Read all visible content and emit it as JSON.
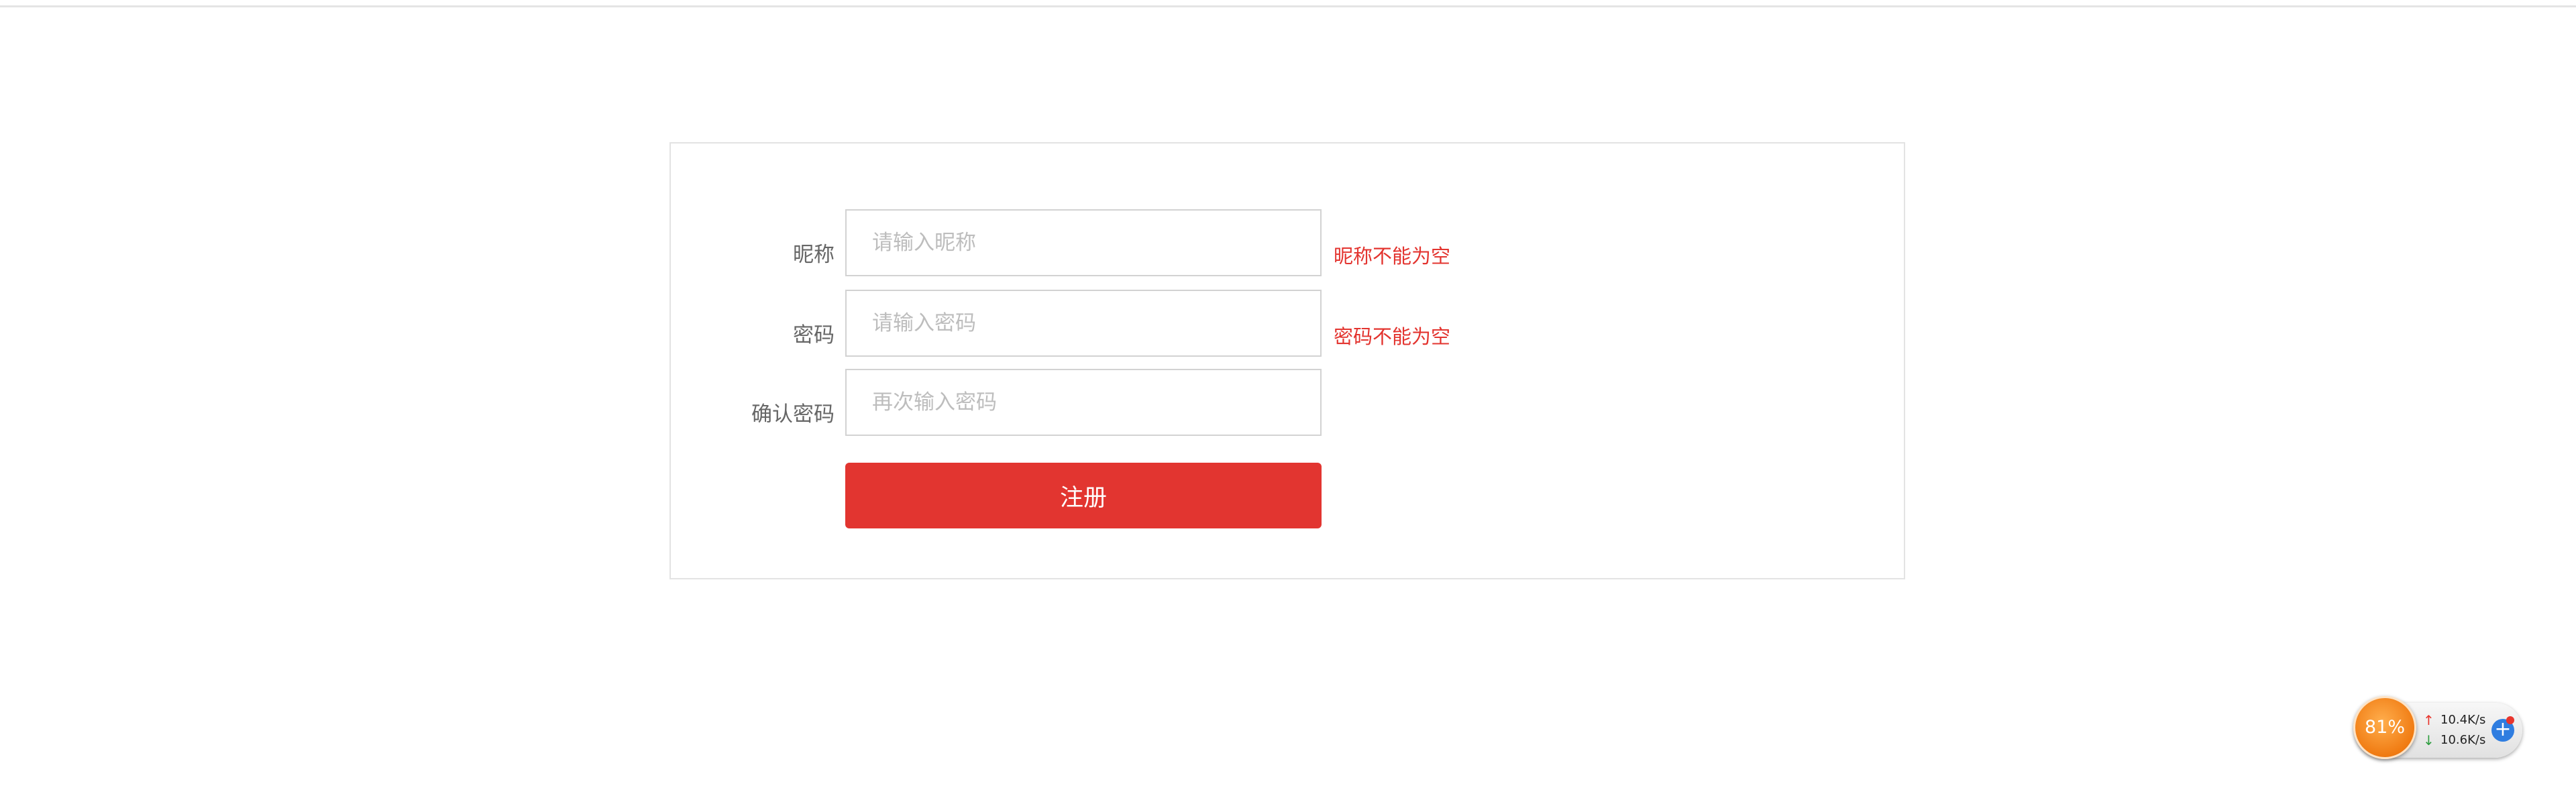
{
  "form": {
    "nickname": {
      "label": "昵称",
      "placeholder": "请输入昵称",
      "value": "",
      "error": "昵称不能为空"
    },
    "password": {
      "label": "密码",
      "placeholder": "请输入密码",
      "value": "",
      "error": "密码不能为空"
    },
    "confirm_password": {
      "label": "确认密码",
      "placeholder": "再次输入密码",
      "value": ""
    },
    "submit_label": "注册"
  },
  "net_widget": {
    "usage_percent": "81%",
    "upload_speed": "10.4K/s",
    "download_speed": "10.6K/s",
    "upload_icon": "arrow-up-icon",
    "download_icon": "arrow-down-icon",
    "upload_color": "#e8352d",
    "download_color": "#2e9e3f",
    "gauge_color": "#f07b12"
  },
  "colors": {
    "accent": "#e23530",
    "error_text": "#e3342f",
    "label_text": "#666666"
  }
}
